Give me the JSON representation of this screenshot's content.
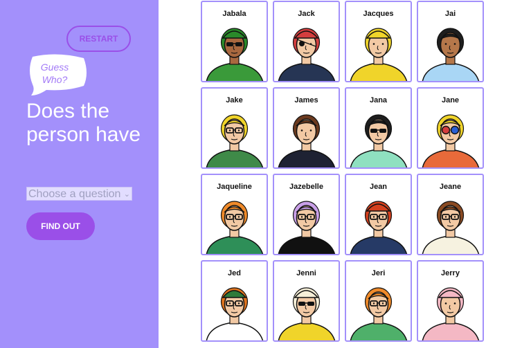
{
  "sidebar": {
    "restart_label": "RESTART",
    "logo_text": "Guess Who?",
    "question_text": "Does the person have",
    "select_placeholder": "Choose a question",
    "find_out_label": "FIND OUT",
    "colors": {
      "background": "#a390fb",
      "accent": "#9a4fe8"
    }
  },
  "board": {
    "cards": [
      {
        "name": "Jabala",
        "skin": "#a9683f",
        "hair": "#2a8a2a",
        "shirt": "#3a9a3a",
        "hat": "#2a8a2a",
        "glasses": "sunglasses"
      },
      {
        "name": "Jack",
        "skin": "#f2c9a4",
        "hair": "#d43e3e",
        "shirt": "#263554",
        "hat": "#d43e3e",
        "glasses": "eyepatch"
      },
      {
        "name": "Jacques",
        "skin": "#f2c9a4",
        "hair": "#f0d42a",
        "shirt": "#f0d42a",
        "hat": "#f0d42a",
        "glasses": "none"
      },
      {
        "name": "Jai",
        "skin": "#b5774a",
        "hair": "#1e1e1e",
        "shirt": "#a9d6f5",
        "hat": "",
        "glasses": "none"
      },
      {
        "name": "Jake",
        "skin": "#f2c9a4",
        "hair": "#f0d42a",
        "shirt": "#3f8a48",
        "hat": "",
        "glasses": "glasses"
      },
      {
        "name": "James",
        "skin": "#f2c9a4",
        "hair": "#6b3a1f",
        "shirt": "#1e2233",
        "hat": "",
        "glasses": "none"
      },
      {
        "name": "Jana",
        "skin": "#f2c9a4",
        "hair": "#1e1e1e",
        "shirt": "#8fe0c0",
        "hat": "",
        "glasses": "sunglasses"
      },
      {
        "name": "Jane",
        "skin": "#f2c9a4",
        "hair": "#f0d42a",
        "shirt": "#e86a3a",
        "hat": "",
        "glasses": "3d"
      },
      {
        "name": "Jaqueline",
        "skin": "#f2c9a4",
        "hair": "#ef8a2a",
        "shirt": "#2e8f58",
        "hat": "",
        "glasses": "glasses"
      },
      {
        "name": "Jazebelle",
        "skin": "#f2c9a4",
        "hair": "#c9a0e8",
        "shirt": "#111111",
        "hat": "",
        "glasses": "glasses"
      },
      {
        "name": "Jean",
        "skin": "#f2c9a4",
        "hair": "#d4401e",
        "shirt": "#263a66",
        "hat": "#d4401e",
        "glasses": "glasses"
      },
      {
        "name": "Jeane",
        "skin": "#f2c9a4",
        "hair": "#8a4a22",
        "shirt": "#f6f2e0",
        "hat": "",
        "glasses": "glasses"
      },
      {
        "name": "Jed",
        "skin": "#f2c9a4",
        "hair": "#e0741e",
        "shirt": "#ffffff",
        "hat": "#2e7a3a",
        "glasses": "glasses"
      },
      {
        "name": "Jenni",
        "skin": "#f2c9a4",
        "hair": "#f6efd8",
        "shirt": "#f0d42a",
        "hat": "#f6efd8",
        "glasses": "sunglasses"
      },
      {
        "name": "Jeri",
        "skin": "#f2c9a4",
        "hair": "#ef8a2a",
        "shirt": "#4fb06a",
        "hat": "",
        "glasses": "glasses"
      },
      {
        "name": "Jerry",
        "skin": "#f2c9a4",
        "hair": "#f4b8c4",
        "shirt": "#f4b8c4",
        "hat": "#f4b8c4",
        "glasses": "none"
      }
    ]
  }
}
